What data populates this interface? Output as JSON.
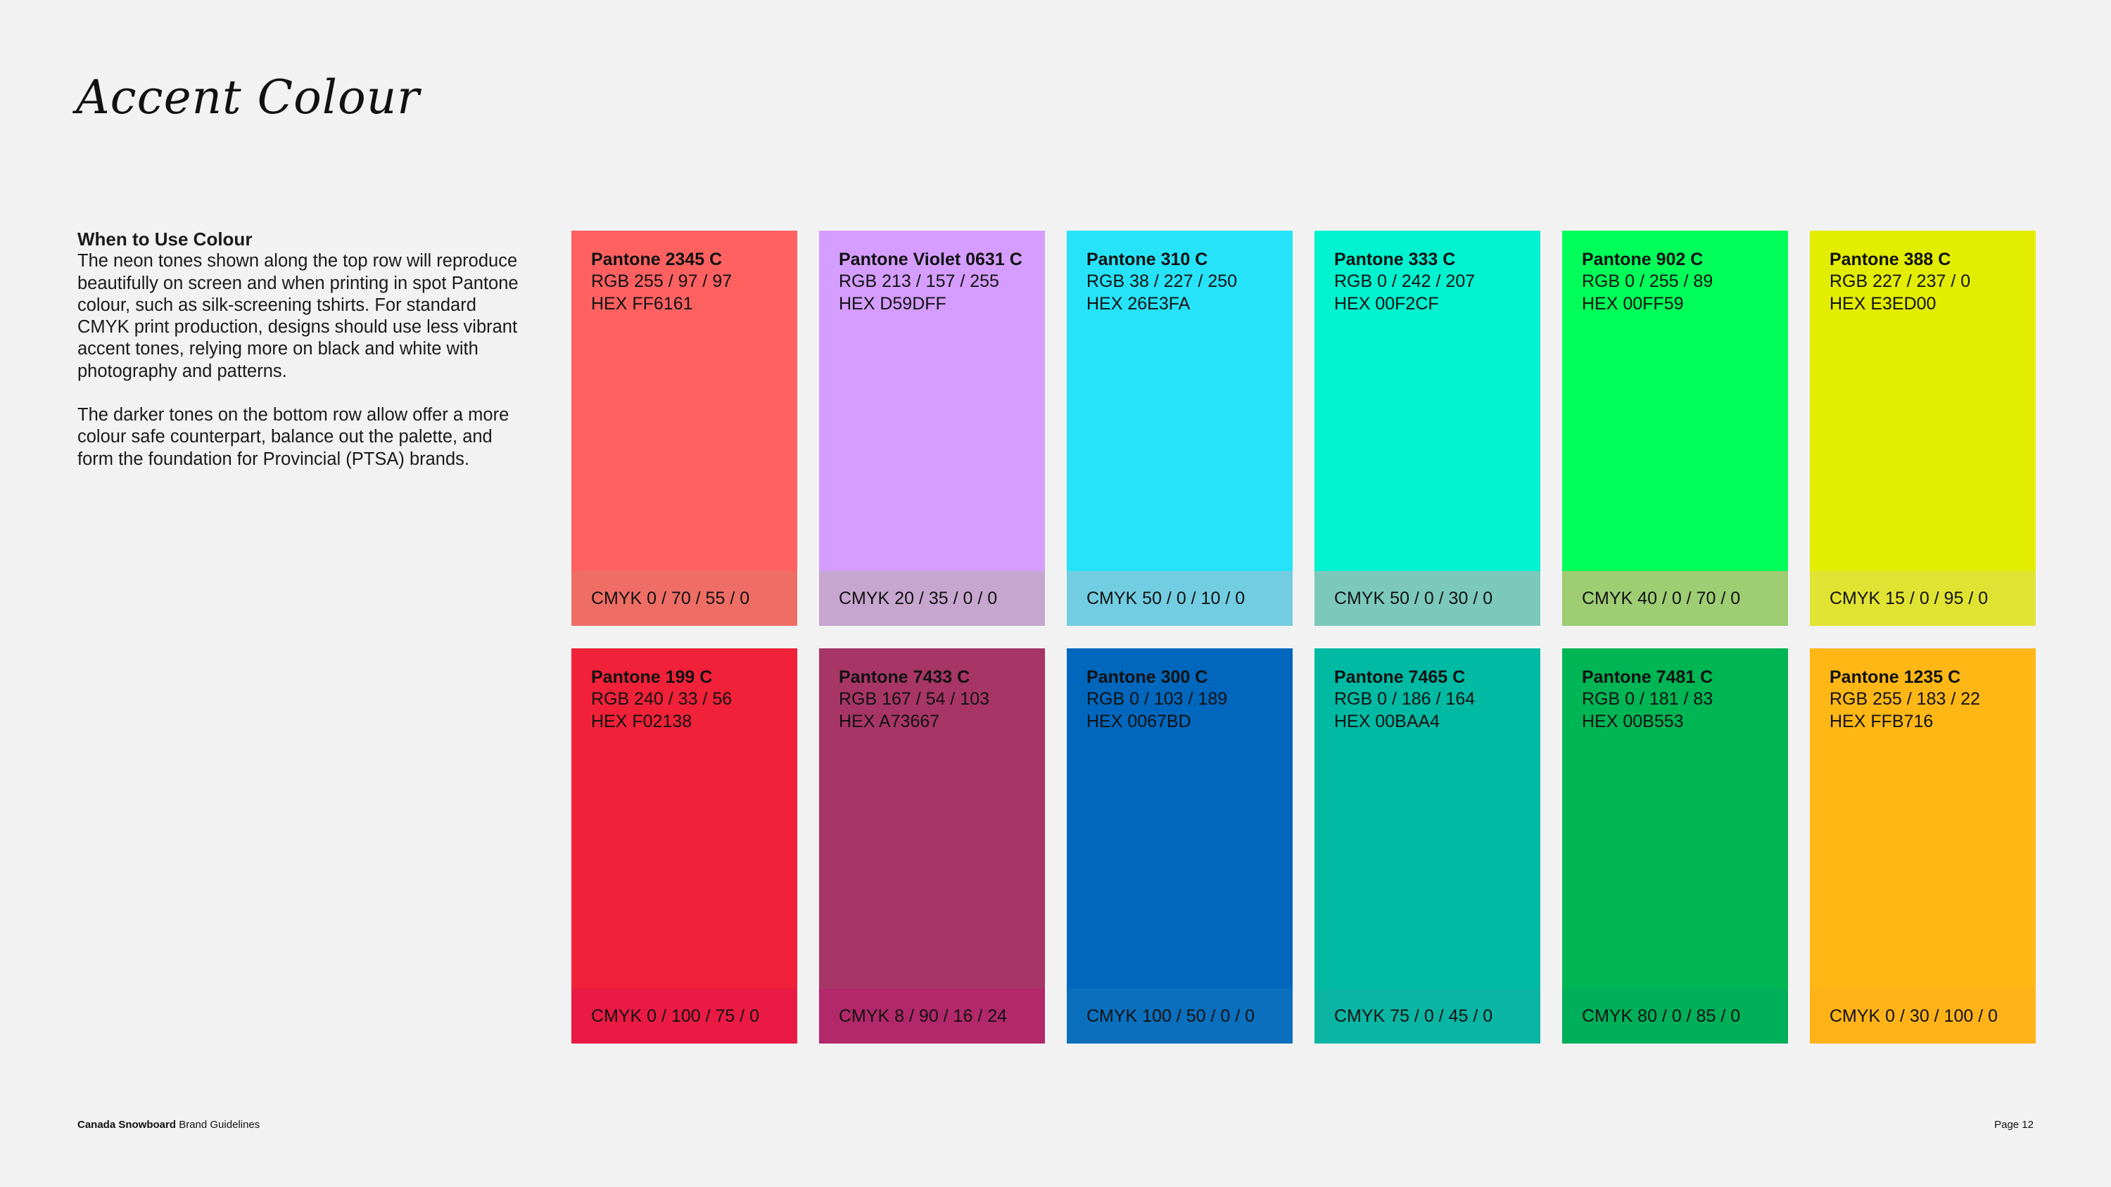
{
  "page": {
    "title": "Accent Colour",
    "section_heading": "When to Use Colour",
    "paragraphs": [
      "The neon tones shown along the top row will reproduce beautifully on screen and when printing in spot Pantone colour, such as silk-screening tshirts. For standard CMYK print production, designs should use less vibrant accent tones, relying more on black and white with photography and patterns.",
      "The darker tones on the bottom row allow offer a more colour safe counterpart, balance out the palette, and form the foundation for Provincial (PTSA) brands."
    ]
  },
  "swatches": [
    {
      "name": "Pantone 2345 C",
      "rgb": "RGB 255 / 97 / 97",
      "hex": "HEX FF6161",
      "cmyk": "CMYK 0 / 70 / 55 / 0",
      "color": "#FF6161",
      "band_color": "#EE6E65"
    },
    {
      "name": "Pantone Violet 0631 C",
      "rgb": "RGB 213 / 157 / 255",
      "hex": "HEX D59DFF",
      "cmyk": "CMYK 20 / 35 / 0 / 0",
      "color": "#D59DFF",
      "band_color": "#C6A6CE"
    },
    {
      "name": "Pantone 310 C",
      "rgb": "RGB 38 / 227 / 250",
      "hex": "HEX 26E3FA",
      "cmyk": "CMYK 50 / 0 / 10 / 0",
      "color": "#26E3FA",
      "band_color": "#72CDE2"
    },
    {
      "name": "Pantone 333 C",
      "rgb": "RGB 0 / 242 / 207",
      "hex": "HEX 00F2CF",
      "cmyk": "CMYK 50 / 0 / 30 / 0",
      "color": "#00F2CF",
      "band_color": "#7CC9BC"
    },
    {
      "name": "Pantone 902 C",
      "rgb": "RGB 0 / 255 / 89",
      "hex": "HEX 00FF59",
      "cmyk": "CMYK 40 / 0 / 70 / 0",
      "color": "#00FF59",
      "band_color": "#9ECD74"
    },
    {
      "name": "Pantone 388 C",
      "rgb": "RGB 227 / 237 / 0",
      "hex": "HEX E3ED00",
      "cmyk": "CMYK 15 / 0 / 95 / 0",
      "color": "#E3ED00",
      "band_color": "#E1E332"
    },
    {
      "name": "Pantone 199 C",
      "rgb": "RGB 240 / 33 / 56",
      "hex": "HEX F02138",
      "cmyk": "CMYK 0 / 100 / 75 / 0",
      "color": "#F02138",
      "band_color": "#EA1A45"
    },
    {
      "name": "Pantone 7433 C",
      "rgb": "RGB 167 / 54 / 103",
      "hex": "HEX A73667",
      "cmyk": "CMYK 8 / 90 / 16 / 24",
      "color": "#A73667",
      "band_color": "#B2286A"
    },
    {
      "name": "Pantone 300 C",
      "rgb": "RGB 0 / 103 / 189",
      "hex": "HEX 0067BD",
      "cmyk": "CMYK 100 / 50 / 0 / 0",
      "color": "#0067BD",
      "band_color": "#0A70BE"
    },
    {
      "name": "Pantone 7465 C",
      "rgb": "RGB 0 / 186 / 164",
      "hex": "HEX 00BAA4",
      "cmyk": "CMYK 75 / 0 / 45 / 0",
      "color": "#00BAA4",
      "band_color": "#0AB6A3"
    },
    {
      "name": "Pantone 7481 C",
      "rgb": "RGB 0 / 181 / 83",
      "hex": "HEX 00B553",
      "cmyk": "CMYK 80 / 0 / 85 / 0",
      "color": "#00B553",
      "band_color": "#00AF59"
    },
    {
      "name": "Pantone 1235 C",
      "rgb": "RGB 255 / 183 / 22",
      "hex": "HEX FFB716",
      "cmyk": "CMYK 0 / 30 / 100 / 0",
      "color": "#FFB716",
      "band_color": "#FFB319"
    }
  ],
  "footer": {
    "brand_bold": "Canada Snowboard",
    "brand_rest": " Brand Guidelines",
    "page": "Page 12"
  }
}
